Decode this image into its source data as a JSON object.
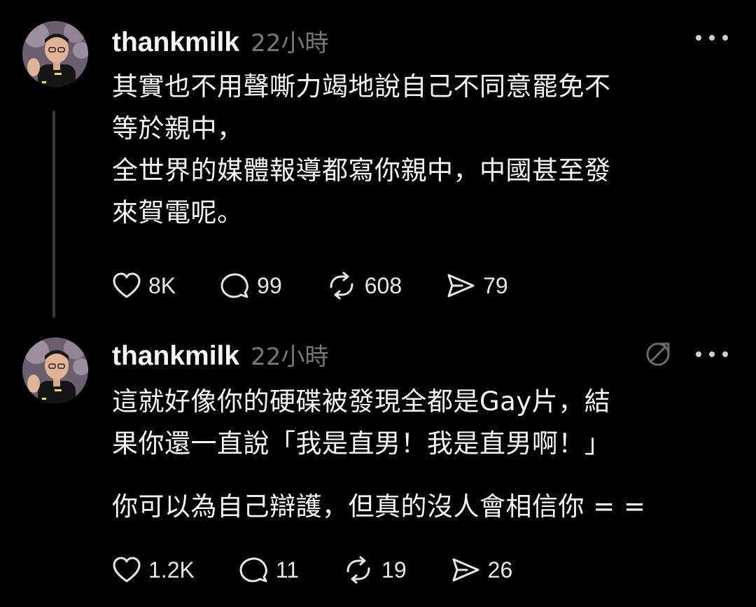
{
  "posts": [
    {
      "username": "thankmilk",
      "timestamp": "22小時",
      "text": "其實也不用聲嘶力竭地說自己不同意罷免不\n等於親中，\n全世界的媒體報導都寫你親中，中國甚至發\n來賀電呢。",
      "actions": {
        "like_count": "8K",
        "reply_count": "99",
        "repost_count": "608",
        "share_count": "79"
      },
      "icons": [
        "heart-icon",
        "comment-icon",
        "repost-icon",
        "share-icon",
        "more-icon"
      ]
    },
    {
      "username": "thankmilk",
      "timestamp": "22小時",
      "text": "這就好像你的硬碟被發現全都是Gay片，結\n果你還一直說「我是直男！我是直男啊！」",
      "text_2": "你可以為自己辯護，但真的沒人會相信你 = =",
      "actions": {
        "like_count": "1.2K",
        "reply_count": "11",
        "repost_count": "19",
        "share_count": "26"
      },
      "icons": [
        "heart-icon",
        "comment-icon",
        "repost-icon",
        "share-icon",
        "more-icon",
        "mute-icon"
      ]
    }
  ],
  "colors": {
    "background": "#000000",
    "text": "#f3f5f7",
    "secondary": "#777777",
    "thread_line": "#3a3a3a"
  }
}
